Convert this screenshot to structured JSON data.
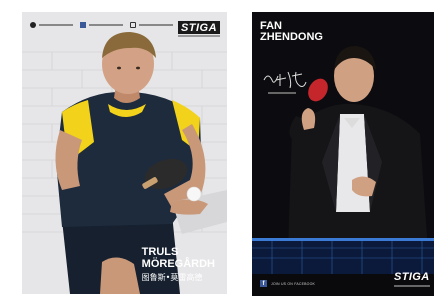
{
  "posters": [
    {
      "player_first_name": "TRULS",
      "player_last_name": "MÖREGÅRDH",
      "player_name_chinese": "图鲁斯•莫雷高德",
      "brand": "STIGA",
      "icons": [
        "tiktok-icon",
        "facebook-icon",
        "instagram-icon"
      ]
    },
    {
      "player_first_name": "FAN",
      "player_last_name": "ZHENDONG",
      "signature": "樊振东",
      "brand": "STIGA",
      "social_text": "JOIN US ON FACEBOOK",
      "facebook_glyph": "f"
    }
  ],
  "colors": {
    "poster1_background": "#e2e2e4",
    "poster1_shirt": "#1d2b3c",
    "poster1_shirt_accent": "#f2d21a",
    "poster2_background": "#0c0c10",
    "net_blue": "#3b7bd6",
    "facebook_blue": "#3b5998"
  }
}
